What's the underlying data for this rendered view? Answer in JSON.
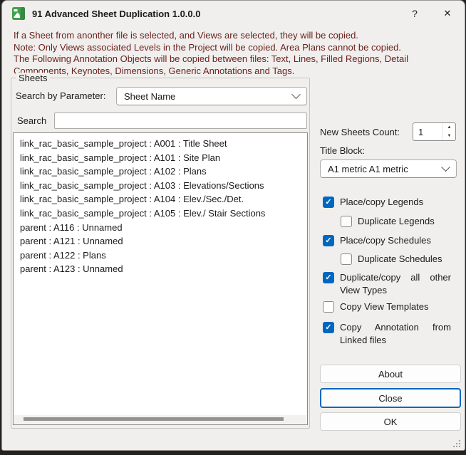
{
  "window": {
    "title": "91 Advanced Sheet Duplication 1.0.0.0",
    "help_glyph": "?",
    "close_glyph": "✕"
  },
  "notice": {
    "lines": [
      "If a Sheet from anonther file is selected, and Views are selected, they will be copied.",
      "Note: Only Views associated Levels in the Project will be copied. Area Plans cannot be copied.",
      "The Following Annotation Objects will be copied between files: Text, Lines, Filled Regions, Detail",
      "Components, Keynotes, Dimensions, Generic Annotations and Tags."
    ]
  },
  "sheets": {
    "group_label": "Sheets",
    "search_by_label": "Search by Parameter:",
    "parameter_value": "Sheet Name",
    "search_label": "Search",
    "search_value": "",
    "items": [
      "link_rac_basic_sample_project : A001 : Title Sheet",
      "link_rac_basic_sample_project : A101 : Site Plan",
      "link_rac_basic_sample_project : A102 : Plans",
      "link_rac_basic_sample_project : A103 : Elevations/Sections",
      "link_rac_basic_sample_project : A104 : Elev./Sec./Det.",
      "link_rac_basic_sample_project : A105 : Elev./ Stair Sections",
      "parent : A116 : Unnamed",
      "parent : A121 : Unnamed",
      "parent : A122 : Plans",
      "parent : A123 : Unnamed"
    ]
  },
  "options": {
    "new_sheets_count_label": "New Sheets Count:",
    "new_sheets_count_value": "1",
    "title_block_label": "Title Block:",
    "title_block_value": "A1 metric A1 metric",
    "checkboxes": [
      {
        "label": "Place/copy Legends",
        "checked": true
      },
      {
        "label": "Duplicate Legends",
        "checked": false
      },
      {
        "label": "Place/copy Schedules",
        "checked": true
      },
      {
        "label": "Duplicate Schedules",
        "checked": false
      },
      {
        "label": "Duplicate/copy all other View Types",
        "checked": true
      },
      {
        "label": "Copy View Templates",
        "checked": false
      },
      {
        "label": "Copy Annotation from Linked files",
        "checked": true
      }
    ]
  },
  "buttons": {
    "about": "About",
    "close": "Close",
    "ok": "OK"
  },
  "icons": {
    "check": "✓",
    "spinner_up": "▲",
    "spinner_down": "▼"
  },
  "colors": {
    "accent": "#0067C0",
    "notice_text": "#6b221e",
    "app_icon_green": "#3fa14e"
  }
}
